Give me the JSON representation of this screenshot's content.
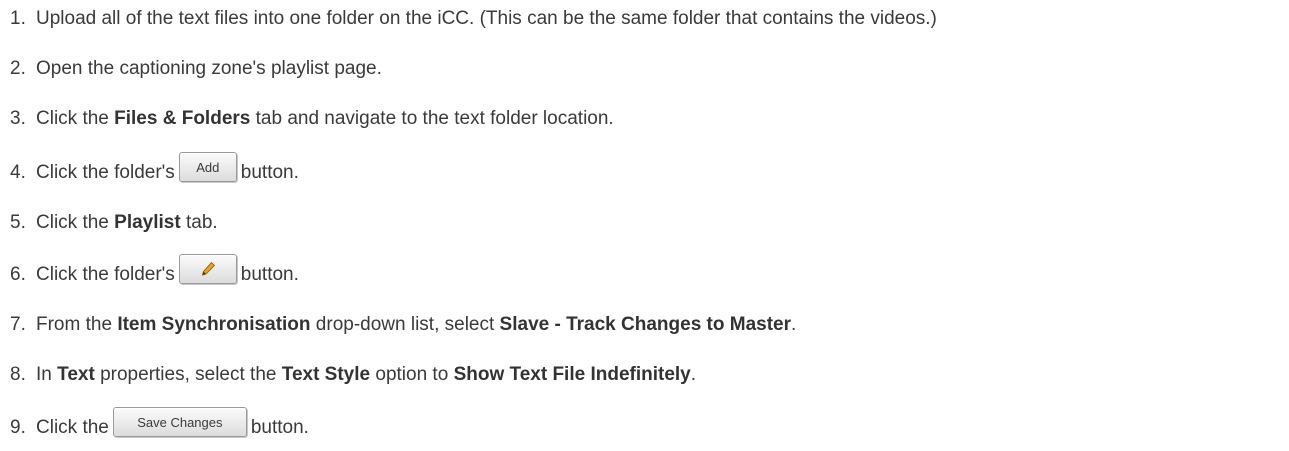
{
  "steps": [
    {
      "number": "1.",
      "text": "Upload all of the text files into one folder on the iCC. (This can be the same folder that contains the videos.)"
    },
    {
      "number": "2.",
      "text": "Open the captioning zone's playlist page."
    },
    {
      "number": "3.",
      "pre": "Click the",
      "bold": "Files & Folders",
      "post": "tab and navigate to the text folder location."
    },
    {
      "number": "4.",
      "pre": "Click the folder's",
      "button_label": "Add",
      "post": "button."
    },
    {
      "number": "5.",
      "pre": "Click the",
      "bold": "Playlist",
      "post": "tab."
    },
    {
      "number": "6.",
      "pre": "Click the folder's",
      "button_icon": "pencil-edit-icon",
      "post": "button."
    },
    {
      "number": "7.",
      "pre": "From the",
      "bold1": "Item Synchronisation",
      "mid": "drop-down list, select",
      "bold2": "Slave - Track Changes to Master",
      "end": "."
    },
    {
      "number": "8.",
      "pre": "In",
      "bold1": "Text",
      "mid1": "properties, select the",
      "bold2": "Text Style",
      "mid2": "option to",
      "bold3": "Show Text File Indefinitely",
      "end": "."
    },
    {
      "number": "9.",
      "pre": "Click the",
      "button_label": "Save Changes",
      "post": "button."
    }
  ],
  "colors": {
    "text": "#3a3a3a",
    "button_border": "#9a9a9a",
    "button_fill": "#ececec",
    "pencil": "#e8a316"
  }
}
